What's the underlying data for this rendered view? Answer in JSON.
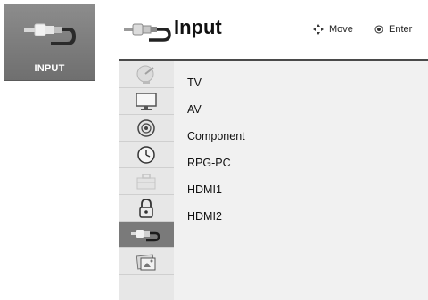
{
  "sidebar_tile": {
    "label": "INPUT",
    "icon": "cable-plug-icon"
  },
  "header": {
    "title": "Input",
    "hints": {
      "move": "Move",
      "enter": "Enter"
    }
  },
  "menu_icons": [
    {
      "name": "satellite-dish-icon",
      "active": false
    },
    {
      "name": "monitor-icon",
      "active": false
    },
    {
      "name": "speaker-icon",
      "active": false
    },
    {
      "name": "clock-icon",
      "active": false
    },
    {
      "name": "toolbox-icon",
      "active": false
    },
    {
      "name": "lock-icon",
      "active": false
    },
    {
      "name": "cable-plug-icon",
      "active": true
    },
    {
      "name": "photo-music-icon",
      "active": false
    }
  ],
  "options": [
    "TV",
    "AV",
    "Component",
    "RPG-PC",
    "HDMI1",
    "HDMI2"
  ]
}
